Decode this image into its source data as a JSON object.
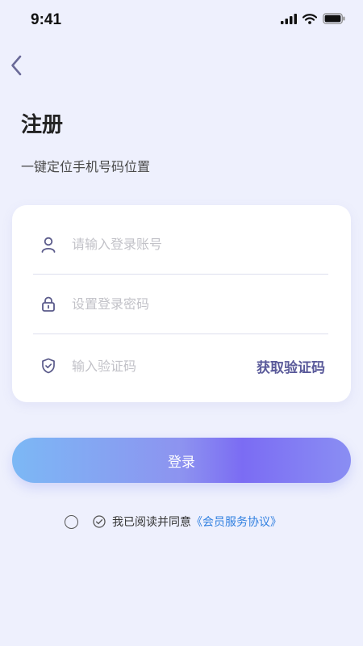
{
  "status_bar": {
    "time": "9:41"
  },
  "header": {
    "title": "注册",
    "subtitle": "一键定位手机号码位置"
  },
  "form": {
    "account": {
      "placeholder": "请输入登录账号",
      "value": ""
    },
    "password": {
      "placeholder": "设置登录密码",
      "value": ""
    },
    "code": {
      "placeholder": "输入验证码",
      "value": ""
    },
    "get_code_label": "获取验证码"
  },
  "login_button": {
    "label": "登录"
  },
  "agreement": {
    "text": "我已阅读并同意",
    "link_text": "《会员服务协议》"
  },
  "icons": {
    "back": "chevron-left-icon",
    "account": "user-icon",
    "password": "lock-icon",
    "code": "shield-check-icon",
    "agree": "check-circle-icon"
  },
  "colors": {
    "background": "#eef0fd",
    "accent": "#5a5a9a",
    "link": "#2f7fe0",
    "button_gradient_start": "#7cb8f5",
    "button_gradient_end": "#7b6cf3"
  }
}
